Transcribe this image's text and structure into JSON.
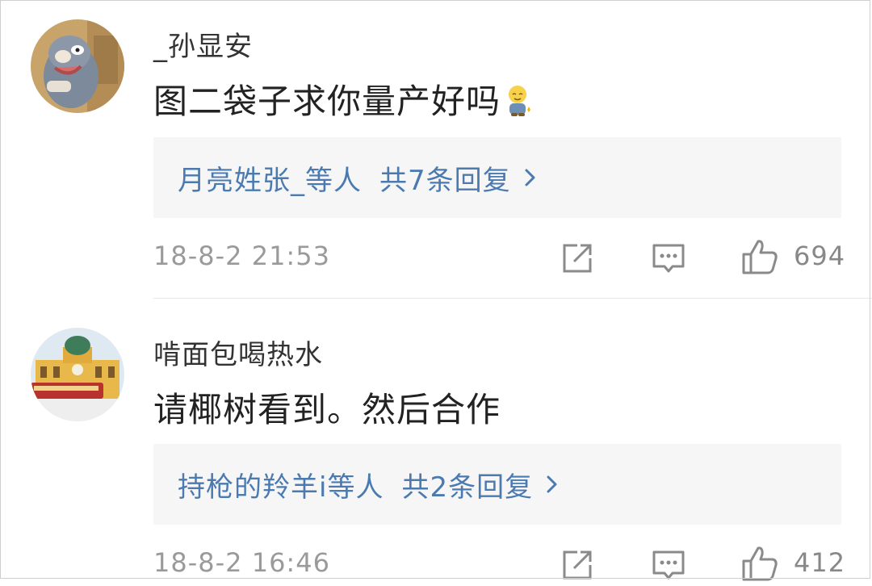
{
  "comments": [
    {
      "username": "_孙显安",
      "content": "图二袋子求你量产好吗",
      "reply_users": "月亮姓张_等人",
      "reply_count": "共7条回复",
      "timestamp": "18-8-2 21:53",
      "likes": "694"
    },
    {
      "username": "啃面包喝热水",
      "content": "请椰树看到。然后合作",
      "reply_users": "持枪的羚羊i等人",
      "reply_count": "共2条回复",
      "timestamp": "18-8-2 16:46",
      "likes": "412"
    }
  ],
  "colors": {
    "link": "#4a7ab0",
    "meta_text": "#9a9a9a",
    "reply_bg": "#f6f6f6"
  },
  "icons": [
    "share-icon",
    "comment-icon",
    "like-icon",
    "chevron-right-icon",
    "emoji-icon"
  ]
}
